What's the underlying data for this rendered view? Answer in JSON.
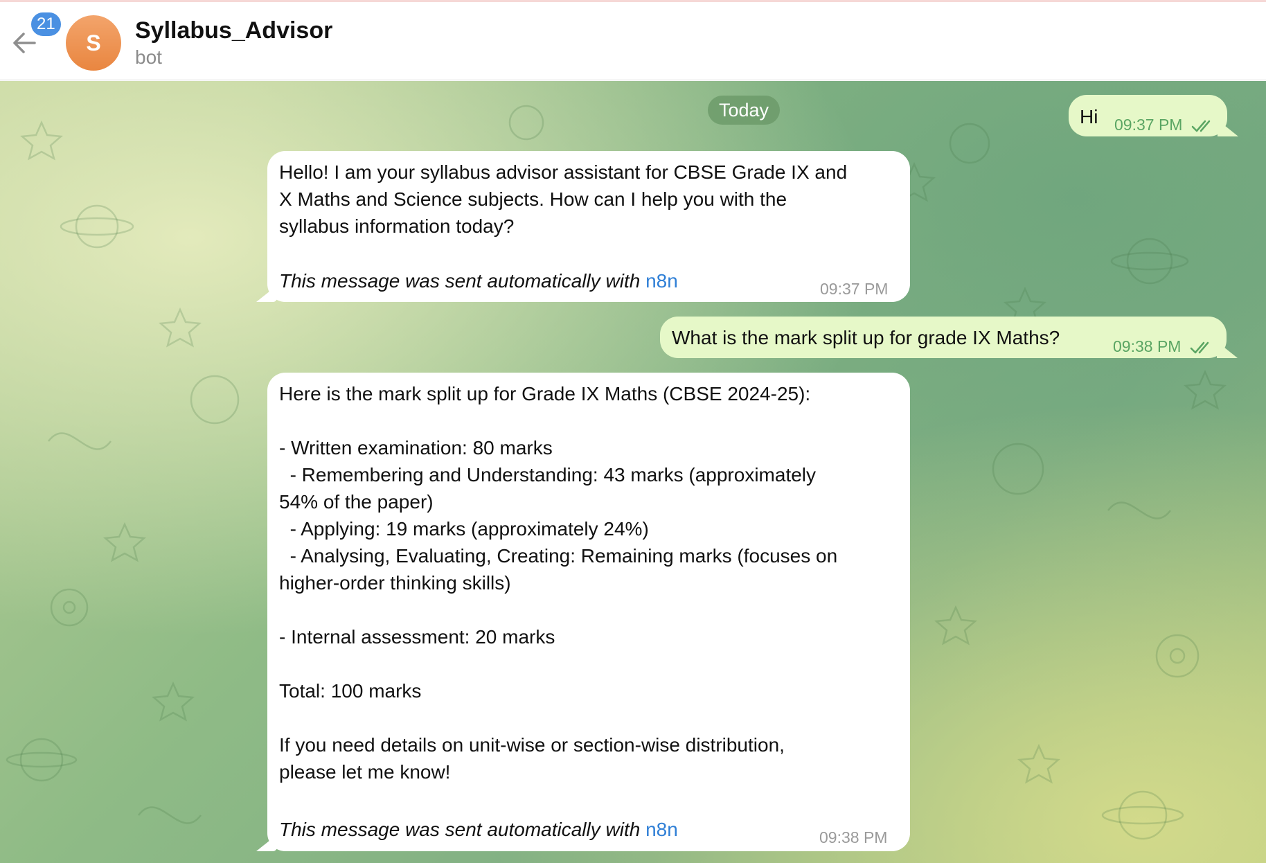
{
  "header": {
    "unread_count": "21",
    "avatar_letter": "S",
    "title": "Syllabus_Advisor",
    "subtitle": "bot"
  },
  "chat": {
    "date_label": "Today",
    "messages": [
      {
        "direction": "outgoing",
        "text": "Hi",
        "time": "09:37 PM",
        "status": "read"
      },
      {
        "direction": "incoming",
        "text": "Hello! I am your syllabus advisor assistant for CBSE Grade IX and\nX Maths and Science subjects. How can I help you with the\nsyllabus information today?",
        "footer_prefix": "This message was sent automatically with ",
        "footer_link": "n8n",
        "time": "09:37 PM"
      },
      {
        "direction": "outgoing",
        "text": "What is the mark split up for grade IX Maths?",
        "time": "09:38 PM",
        "status": "read"
      },
      {
        "direction": "incoming",
        "text": "Here is the mark split up for Grade IX Maths (CBSE 2024-25):\n\n- Written examination: 80 marks\n  - Remembering and Understanding: 43 marks (approximately\n54% of the paper)\n  - Applying: 19 marks (approximately 24%)\n  - Analysing, Evaluating, Creating: Remaining marks (focuses on\nhigher-order thinking skills)\n\n- Internal assessment: 20 marks\n\nTotal: 100 marks\n\nIf you need details on unit-wise or section-wise distribution,\nplease let me know!",
        "footer_prefix": "This message was sent automatically with ",
        "footer_link": "n8n",
        "time": "09:38 PM"
      }
    ]
  },
  "colors": {
    "incoming_bubble": "#ffffff",
    "outgoing_bubble": "#e6f8c8",
    "link": "#2f7fd6",
    "badge": "#4a90e2",
    "avatar": "#e98640"
  },
  "icons": [
    "back-arrow-icon",
    "read-checkmarks-icon"
  ]
}
